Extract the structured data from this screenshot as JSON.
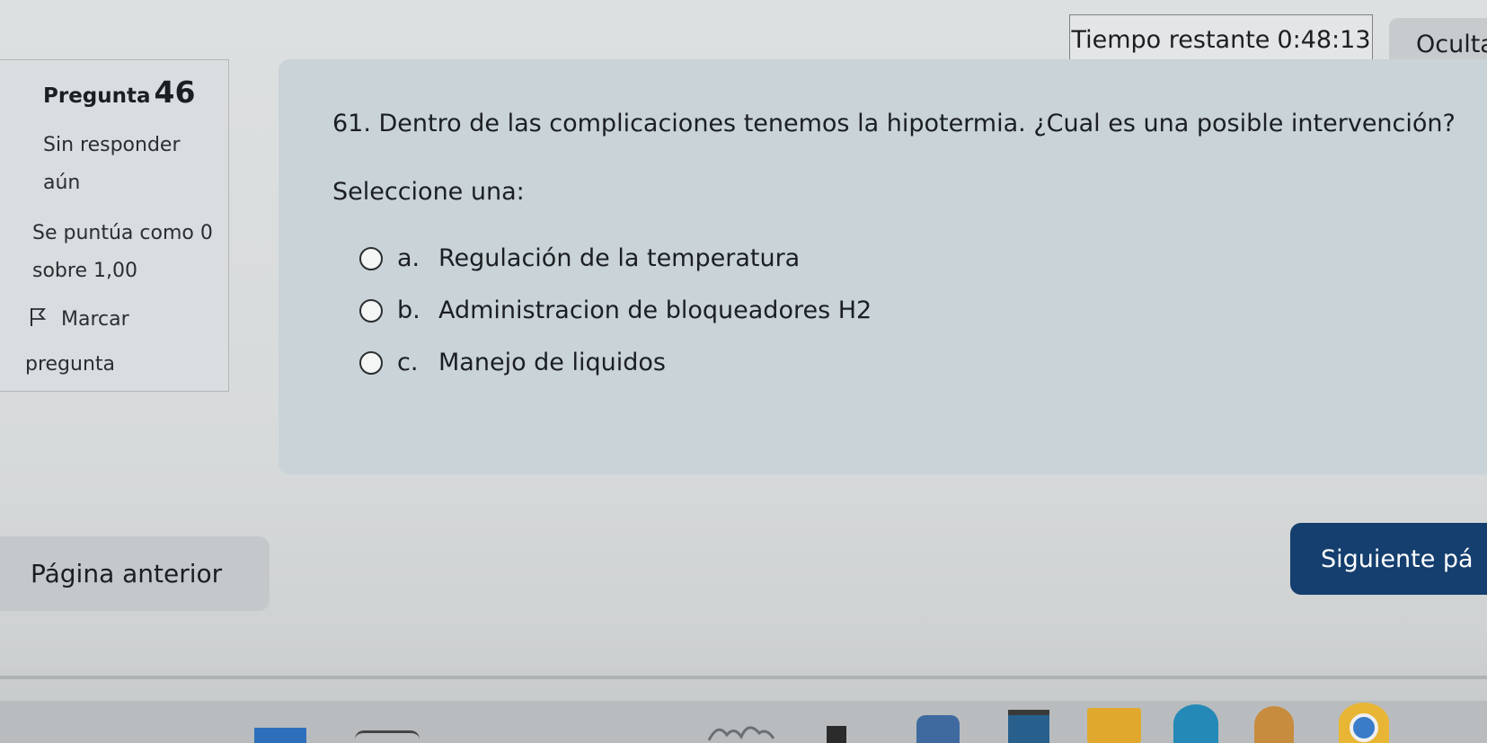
{
  "timer": {
    "label": "Tiempo restante",
    "value": "0:48:13",
    "hide_label": "Ocultar"
  },
  "info": {
    "question_prefix": "Pregunta",
    "question_number": "46",
    "state": "Sin responder aún",
    "grade": "Se puntúa como 0 sobre 1,00",
    "flag_line1": "Marcar",
    "flag_line2": "pregunta"
  },
  "question": {
    "text": "61. Dentro de las complicaciones tenemos la hipotermia. ¿Cual es una posible intervención?",
    "prompt": "Seleccione una:",
    "options": [
      {
        "letter": "a.",
        "label": "Regulación de la temperatura"
      },
      {
        "letter": "b.",
        "label": "Administracion de bloqueadores H2"
      },
      {
        "letter": "c.",
        "label": "Manejo de liquidos"
      }
    ]
  },
  "navigation": {
    "prev_label": "Página anterior",
    "next_label": "Siguiente pá"
  },
  "icons": {
    "flag": "flag-icon",
    "radio": "radio-icon"
  },
  "colors": {
    "next_button": "#143f6f",
    "question_panel": "#c9d3d8"
  }
}
